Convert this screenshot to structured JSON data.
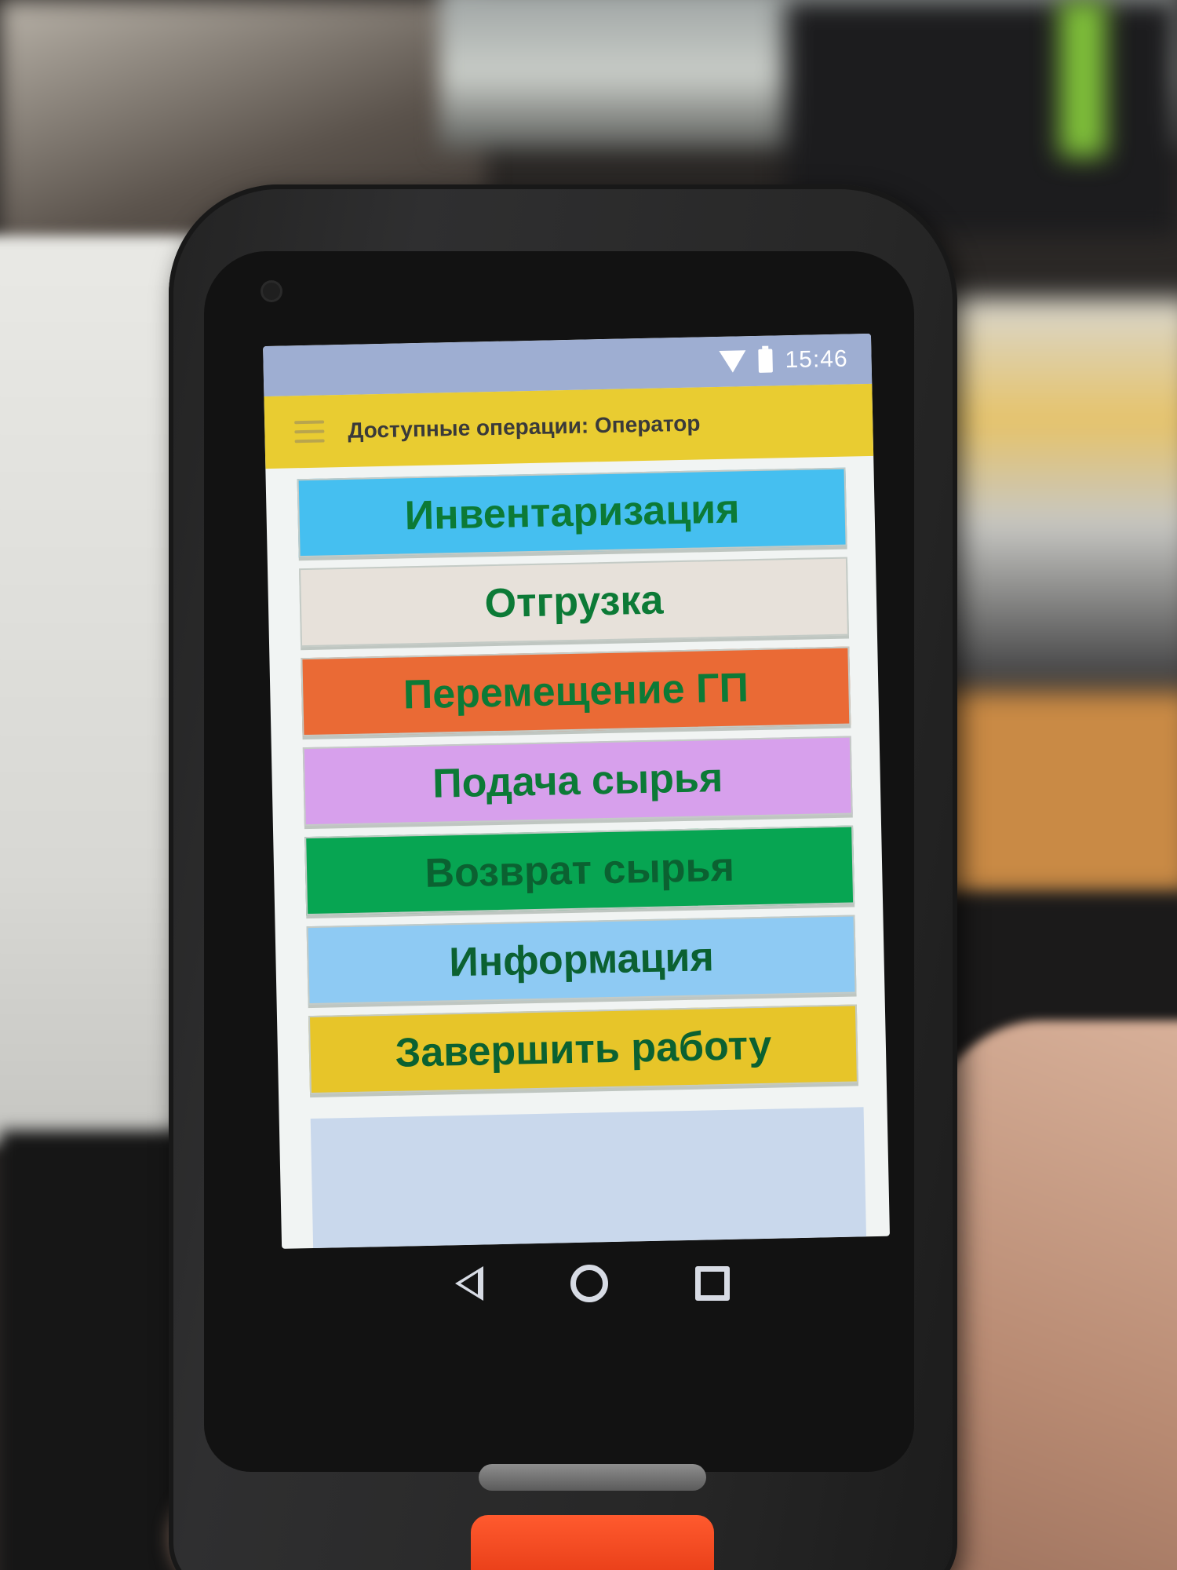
{
  "status_bar": {
    "time": "15:46",
    "icons": [
      "wifi-icon",
      "battery-icon"
    ]
  },
  "app_bar": {
    "menu_icon": "hamburger-menu-icon",
    "title": "Доступные операции: Оператор"
  },
  "operations": [
    {
      "id": "inventory",
      "label": "Инвентаризация",
      "color": "#45bff0"
    },
    {
      "id": "shipment",
      "label": "Отгрузка",
      "color": "#e7e1da"
    },
    {
      "id": "transfer-gp",
      "label": "Перемещение ГП",
      "color": "#ea6a35"
    },
    {
      "id": "raw-supply",
      "label": "Подача сырья",
      "color": "#d7a0ec"
    },
    {
      "id": "raw-return",
      "label": "Возврат сырья",
      "color": "#07a552"
    },
    {
      "id": "information",
      "label": "Информация",
      "color": "#8ecaf3"
    },
    {
      "id": "finish-work",
      "label": "Завершить работу",
      "color": "#e7c529"
    }
  ],
  "nav_bar": {
    "icons": [
      "back-icon",
      "home-icon",
      "recents-icon"
    ]
  },
  "colors": {
    "status_bar": "#9eaed2",
    "app_bar": "#e9cc31",
    "button_text": "#0c7a36",
    "screen_background": "#f1f4f3",
    "footer_area": "#c9d8ec"
  }
}
